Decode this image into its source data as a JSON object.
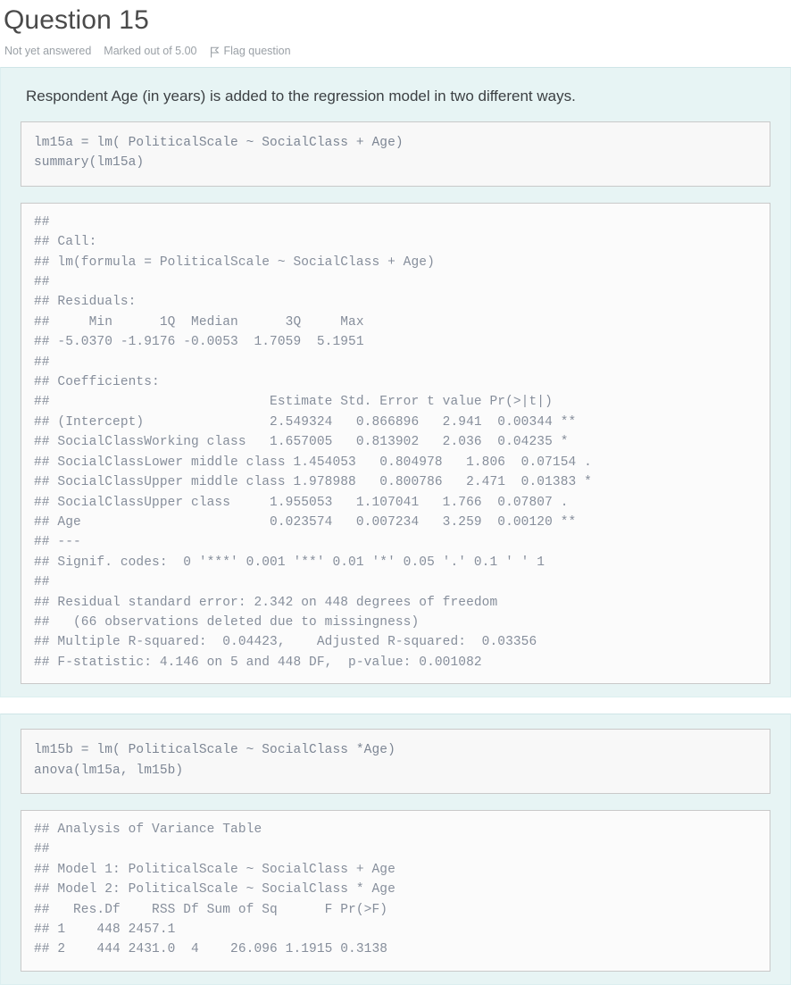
{
  "question": {
    "title": "Question 15",
    "status": "Not yet answered",
    "marks": "Marked out of 5.00",
    "flag_label": "Flag question",
    "flag_icon": "flag-icon"
  },
  "prompt": "Respondent Age (in years) is added to the regression model in two different ways.",
  "blocks": {
    "code_a": "lm15a = lm( PoliticalScale ~ SocialClass + Age)\nsummary(lm15a)",
    "output_a": "## \n## Call:\n## lm(formula = PoliticalScale ~ SocialClass + Age)\n## \n## Residuals:\n##     Min      1Q  Median      3Q     Max \n## -5.0370 -1.9176 -0.0053  1.7059  5.1951 \n## \n## Coefficients:\n##                            Estimate Std. Error t value Pr(>|t|)   \n## (Intercept)                2.549324   0.866896   2.941  0.00344 **\n## SocialClassWorking class   1.657005   0.813902   2.036  0.04235 * \n## SocialClassLower middle class 1.454053   0.804978   1.806  0.07154 . \n## SocialClassUpper middle class 1.978988   0.800786   2.471  0.01383 * \n## SocialClassUpper class     1.955053   1.107041   1.766  0.07807 . \n## Age                        0.023574   0.007234   3.259  0.00120 **\n## ---\n## Signif. codes:  0 '***' 0.001 '**' 0.01 '*' 0.05 '.' 0.1 ' ' 1\n## \n## Residual standard error: 2.342 on 448 degrees of freedom\n##   (66 observations deleted due to missingness)\n## Multiple R-squared:  0.04423,    Adjusted R-squared:  0.03356 \n## F-statistic: 4.146 on 5 and 448 DF,  p-value: 0.001082",
    "code_b": "lm15b = lm( PoliticalScale ~ SocialClass *Age)\nanova(lm15a, lm15b)",
    "output_b": "## Analysis of Variance Table\n## \n## Model 1: PoliticalScale ~ SocialClass + Age\n## Model 2: PoliticalScale ~ SocialClass * Age\n##   Res.Df    RSS Df Sum of Sq      F Pr(>F)\n## 1    448 2457.1                           \n## 2    444 2431.0  4    26.096 1.1915 0.3138"
  },
  "model_a": {
    "call": "lm(formula = PoliticalScale ~ SocialClass + Age)",
    "residuals": {
      "headers": [
        "Min",
        "1Q",
        "Median",
        "3Q",
        "Max"
      ],
      "values": [
        -5.037,
        -1.9176,
        -0.0053,
        1.7059,
        5.1951
      ]
    },
    "coefficients": {
      "headers": [
        "Estimate",
        "Std. Error",
        "t value",
        "Pr(>|t|)"
      ],
      "rows": [
        {
          "term": "(Intercept)",
          "estimate": 2.549324,
          "std_error": 0.866896,
          "t_value": 2.941,
          "p_value": 0.00344,
          "signif": "**"
        },
        {
          "term": "SocialClassWorking class",
          "estimate": 1.657005,
          "std_error": 0.813902,
          "t_value": 2.036,
          "p_value": 0.04235,
          "signif": "*"
        },
        {
          "term": "SocialClassLower middle class",
          "estimate": 1.454053,
          "std_error": 0.804978,
          "t_value": 1.806,
          "p_value": 0.07154,
          "signif": "."
        },
        {
          "term": "SocialClassUpper middle class",
          "estimate": 1.978988,
          "std_error": 0.800786,
          "t_value": 2.471,
          "p_value": 0.01383,
          "signif": "*"
        },
        {
          "term": "SocialClassUpper class",
          "estimate": 1.955053,
          "std_error": 1.107041,
          "t_value": 1.766,
          "p_value": 0.07807,
          "signif": "."
        },
        {
          "term": "Age",
          "estimate": 0.023574,
          "std_error": 0.007234,
          "t_value": 3.259,
          "p_value": 0.0012,
          "signif": "**"
        }
      ]
    },
    "signif_codes": "0 '***' 0.001 '**' 0.01 '*' 0.05 '.' 0.1 ' ' 1",
    "residual_standard_error": 2.342,
    "residual_df": 448,
    "observations_deleted": 66,
    "multiple_r_squared": 0.04423,
    "adjusted_r_squared": 0.03356,
    "f_statistic": 4.146,
    "f_num_df": 5,
    "f_den_df": 448,
    "p_value": 0.001082
  },
  "model_b": {
    "anova_title": "Analysis of Variance Table",
    "model_1": "PoliticalScale ~ SocialClass + Age",
    "model_2": "PoliticalScale ~ SocialClass * Age",
    "headers": [
      "Res.Df",
      "RSS",
      "Df",
      "Sum of Sq",
      "F",
      "Pr(>F)"
    ],
    "rows": [
      {
        "n": 1,
        "res_df": 448,
        "rss": 2457.1,
        "df": "",
        "sum_of_sq": "",
        "f": "",
        "p": ""
      },
      {
        "n": 2,
        "res_df": 444,
        "rss": 2431.0,
        "df": 4,
        "sum_of_sq": 26.096,
        "f": 1.1915,
        "p": 0.3138
      }
    ]
  },
  "colors": {
    "panel_bg": "#e7f4f4",
    "panel_border": "#cfe5e7",
    "code_bg": "#f8f8f8",
    "code_border": "#c9c9c9",
    "code_text": "#7d8694",
    "title_text": "#4a4a4a",
    "meta_text": "#9aa0a6"
  }
}
